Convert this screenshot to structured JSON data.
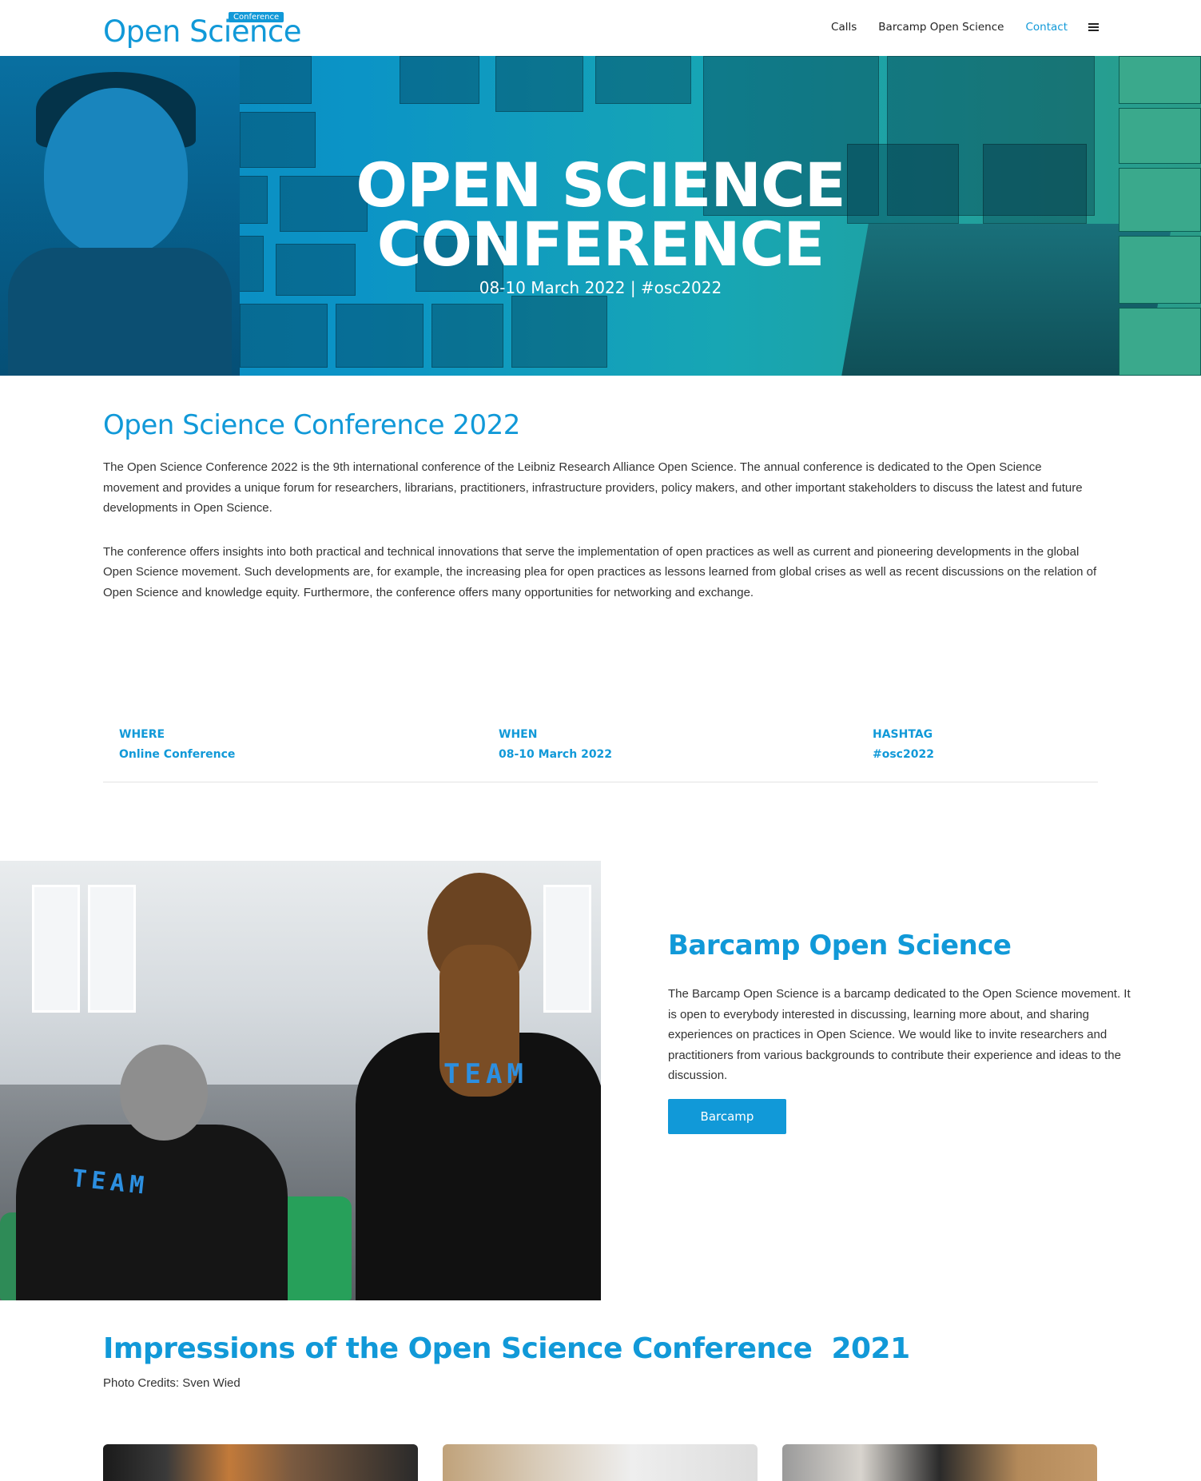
{
  "header": {
    "logo_text": "Open Science",
    "logo_badge": "Conference",
    "nav": [
      {
        "label": "Calls"
      },
      {
        "label": "Barcamp Open Science"
      },
      {
        "label": "Contact"
      }
    ],
    "accent_color": "#1199d8"
  },
  "hero": {
    "title_line1": "OPEN SCIENCE",
    "title_line2": "CONFERENCE",
    "subtitle": "08-10 March 2022 | #osc2022"
  },
  "intro": {
    "heading": "Open Science Conference 2022",
    "paragraphs": [
      "The Open Science Conference 2022 is the 9th international conference of the Leibniz Research Alliance Open Science. The annual conference is dedicated to the Open Science movement and provides a unique forum for researchers, librarians, practitioners, infrastructure providers, policy makers, and other important stakeholders to discuss the latest and future developments in Open Science.",
      "The conference offers insights into both practical and technical innovations that serve the implementation of open practices as well as current and pioneering developments in the global Open Science movement. Such developments are, for example, the increasing plea for open practices as lessons learned from global crises as well as recent discussions on the relation of Open Science and knowledge equity. Furthermore, the conference offers many opportunities for networking and exchange."
    ]
  },
  "info": [
    {
      "label": "WHERE",
      "value": "Online Conference"
    },
    {
      "label": "WHEN",
      "value": "08-10 March 2022"
    },
    {
      "label": "HASHTAG",
      "value": "#osc2022"
    }
  ],
  "barcamp": {
    "heading": "Barcamp Open Science",
    "text": "The Barcamp Open Science is a barcamp dedicated to the Open Science movement. It is open to everybody interested in discussing, learning more about, and sharing experiences on practices in Open Science. We would like to invite researchers and practitioners from various backgrounds to contribute their experience and ideas to the discussion.",
    "button": "Barcamp",
    "shirt_text": "TEAM"
  },
  "impressions": {
    "heading": "Impressions of the Open Science Conference  2021",
    "credits": "Photo Credits: Sven Wied"
  }
}
